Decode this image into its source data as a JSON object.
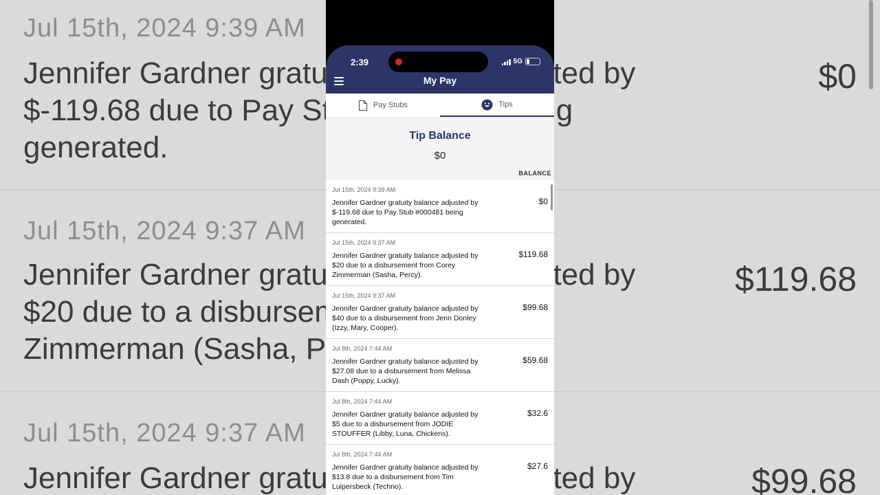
{
  "background": {
    "entries": [
      {
        "date": "Jul 15th, 2024 9:39 AM",
        "text": "Jennifer Gardner gratuity balance adjusted by\n$-119.68  due to Pay Stub #000481 being\ngenerated.",
        "amount": "$0"
      },
      {
        "date": "Jul 15th, 2024 9:37 AM",
        "text": "Jennifer Gardner gratuity balance adjusted by\n$20  due to a disbursement from Corey\nZimmerman (Sasha, Percy).",
        "amount": "$119.68"
      },
      {
        "date": "Jul 15th, 2024 9:37 AM",
        "text": "Jennifer Gardner gratuity balance adjusted by",
        "amount": "$99.68"
      }
    ]
  },
  "status_bar": {
    "time": "2:39",
    "network": "5G"
  },
  "header": {
    "title": "My Pay",
    "menu_icon": "hamburger-icon"
  },
  "tabs": [
    {
      "label": "Pay Stubs",
      "icon": "document-icon",
      "active": false
    },
    {
      "label": "Tips",
      "icon": "smiley-icon",
      "active": true
    }
  ],
  "tip_balance": {
    "title": "Tip Balance",
    "amount": "$0",
    "column_header": "BALANCE"
  },
  "entries": [
    {
      "date": "Jul 15th, 2024 9:39 AM",
      "description": "Jennifer Gardner gratuity balance adjusted by\n$-119.68  due to Pay Stub #000481 being\ngenerated.",
      "balance": "$0"
    },
    {
      "date": "Jul 15th, 2024 9:37 AM",
      "description": "Jennifer Gardner gratuity balance adjusted by\n$20  due to a disbursement from Corey\nZimmerman (Sasha, Percy).",
      "balance": "$119.68"
    },
    {
      "date": "Jul 15th, 2024 9:37 AM",
      "description": "Jennifer Gardner gratuity balance adjusted by\n$40  due to a disbursement from Jenn Donley\n(Izzy, Mary, Cooper).",
      "balance": "$99.68"
    },
    {
      "date": "Jul 8th, 2024 7:44 AM",
      "description": "Jennifer Gardner gratuity balance adjusted by\n$27.08  due to a disbursement from Melissa\nDash (Poppy, Lucky).",
      "balance": "$59.68"
    },
    {
      "date": "Jul 8th, 2024 7:44 AM",
      "description": "Jennifer Gardner gratuity balance adjusted by\n$5  due to a disbursement from JODIE\nSTOUFFER (Libby, Luna, Chickens).",
      "balance": "$32.6"
    },
    {
      "date": "Jul 8th, 2024 7:44 AM",
      "description": "Jennifer Gardner gratuity balance adjusted by\n$13.8  due to a disbursement from Tim\nLuipersbeck (Techno).",
      "balance": "$27.6"
    }
  ],
  "colors": {
    "header_bg": "#2c3468",
    "accent": "#2c3468",
    "record_dot": "#d9232a"
  }
}
